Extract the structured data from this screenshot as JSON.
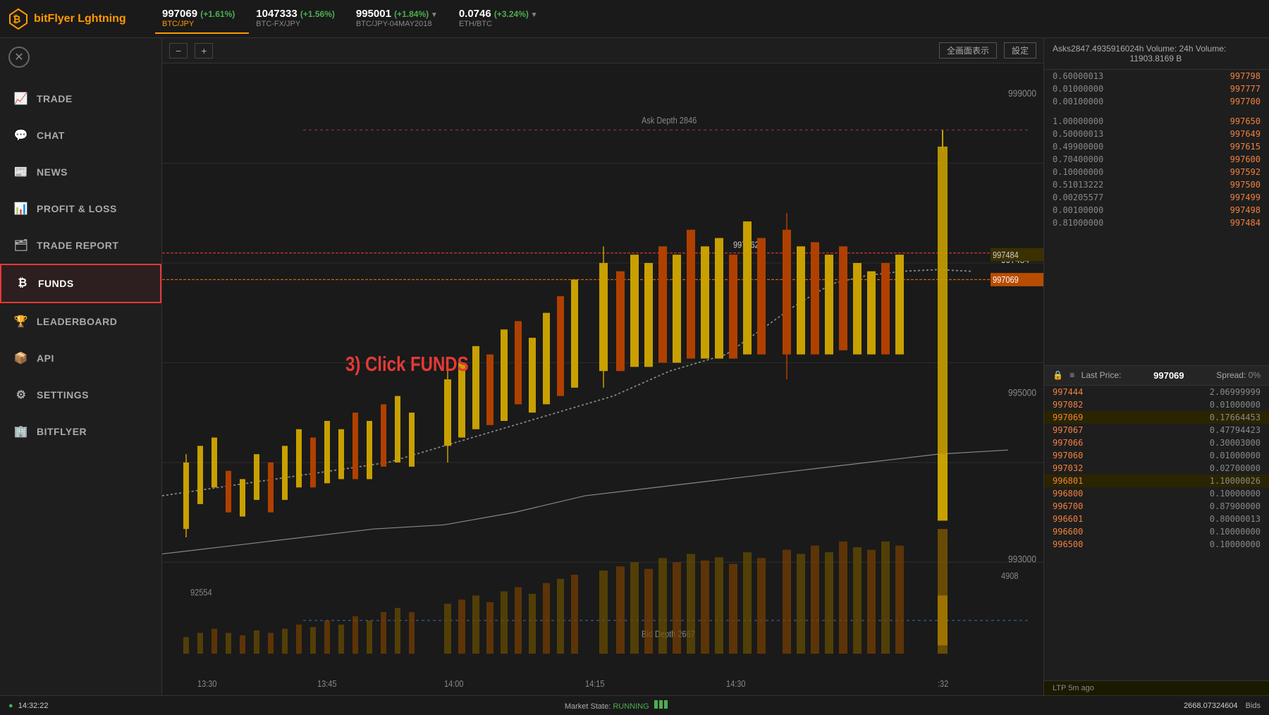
{
  "header": {
    "logo": "bitFlyer Lightning",
    "logo_brand": "bitFlyer",
    "logo_suffix": " L",
    "logo_suffix2": "ghtning",
    "tickers": [
      {
        "price": "997069",
        "change": "(+1.61%)",
        "pair": "BTC/JPY",
        "active": true,
        "arrow": false
      },
      {
        "price": "1047333",
        "change": "(+1.56%)",
        "pair": "BTC-FX/JPY",
        "active": false,
        "arrow": false
      },
      {
        "price": "995001",
        "change": "(+1.84%)",
        "pair": "BTC/JPY-04MAY2018",
        "active": false,
        "arrow": true
      },
      {
        "price": "0.0746",
        "change": "(+3.24%)",
        "pair": "ETH/BTC",
        "active": false,
        "arrow": true
      }
    ]
  },
  "sidebar": {
    "nav_items": [
      {
        "id": "trade",
        "label": "TRADE",
        "icon": "📈"
      },
      {
        "id": "chat",
        "label": "CHAT",
        "icon": "💬"
      },
      {
        "id": "news",
        "label": "NEWS",
        "icon": "📰"
      },
      {
        "id": "profit-loss",
        "label": "PROFIT & LOSS",
        "icon": "📊"
      },
      {
        "id": "trade-report",
        "label": "TRADE REPORT",
        "icon": "🗂"
      },
      {
        "id": "funds",
        "label": "FUNDS",
        "icon": "₿",
        "active": true
      },
      {
        "id": "leaderboard",
        "label": "LEADERBOARD",
        "icon": "🏆"
      },
      {
        "id": "api",
        "label": "API",
        "icon": "📦"
      },
      {
        "id": "settings",
        "label": "SETTINGS",
        "icon": "⚙"
      },
      {
        "id": "bitflyer",
        "label": "BITFLYER",
        "icon": "🏢"
      }
    ]
  },
  "chart": {
    "zoom_minus": "−",
    "zoom_plus": "+",
    "fullscreen_label": "全画面表示",
    "settings_label": "設定",
    "annotation": "3) Click FUNDS",
    "price_labels": [
      "999000",
      "997484",
      "997069",
      "995000",
      "993000"
    ],
    "volume_labels": [
      "4908",
      "92554"
    ],
    "depth_ask": "Ask Depth 2846",
    "depth_bid": "Bid Depth 2667",
    "price_line1": "997462",
    "price_line2": "997484",
    "time_labels": [
      "13:30",
      "13:45",
      "14:00",
      "14:15",
      "14:30",
      ":32"
    ]
  },
  "order_book": {
    "header_left": "Asks",
    "header_mid": "2847.49359160",
    "header_right": "24h Volume: 11903.8169 B",
    "asks": [
      {
        "size": "0.60000013",
        "price": "997798"
      },
      {
        "size": "0.01000000",
        "price": "997777"
      },
      {
        "size": "0.00100000",
        "price": "997700"
      },
      {
        "size": "",
        "price": ""
      },
      {
        "size": "1.00000000",
        "price": "997650"
      },
      {
        "size": "0.50000013",
        "price": "997649"
      },
      {
        "size": "0.49900000",
        "price": "997615"
      },
      {
        "size": "0.70400000",
        "price": "997600"
      },
      {
        "size": "0.10000000",
        "price": "997592"
      },
      {
        "size": "0.51013222",
        "price": "997500"
      },
      {
        "size": "0.00205577",
        "price": "997499"
      },
      {
        "size": "0.00100000",
        "price": "997498"
      },
      {
        "size": "0.81000000",
        "price": "997484"
      }
    ],
    "last_price_label": "Last Price:",
    "last_price": "997069",
    "spread_label": "Spread:",
    "spread": "0%",
    "bids": [
      {
        "price": "997444",
        "size": "2.06999999"
      },
      {
        "price": "997082",
        "size": "0.01000000"
      },
      {
        "price": "997069",
        "size": "0.17664453",
        "highlighted": true
      },
      {
        "price": "997067",
        "size": "0.47794423"
      },
      {
        "price": "997066",
        "size": "0.30003000"
      },
      {
        "price": "997060",
        "size": "0.01000000"
      },
      {
        "price": "997032",
        "size": "0.02700000"
      },
      {
        "price": "996801",
        "size": "1.10000026",
        "highlighted": true
      },
      {
        "price": "996800",
        "size": "0.10000000"
      },
      {
        "price": "996700",
        "size": "0.87900000"
      },
      {
        "price": "996601",
        "size": "0.80000013"
      },
      {
        "price": "996600",
        "size": "0.10000000"
      },
      {
        "price": "996500",
        "size": "0.10000000"
      }
    ],
    "footer": "LTP 5m ago",
    "bids_label": "Bids"
  },
  "status_bar": {
    "timestamp": "14:32:22",
    "market_state_label": "Market State:",
    "market_state": "RUNNING",
    "price": "2668.07324604",
    "bids": "Bids"
  }
}
